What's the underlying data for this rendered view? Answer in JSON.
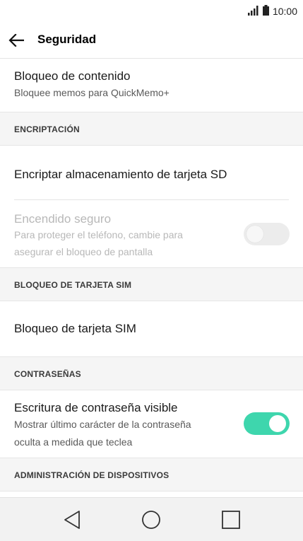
{
  "status_bar": {
    "time": "10:00",
    "signal_icon": "signal-bars-icon",
    "battery_icon": "battery-icon"
  },
  "toolbar": {
    "back_icon": "arrow-left-icon",
    "title": "Seguridad"
  },
  "items": {
    "content_lock": {
      "title": "Bloqueo de contenido",
      "summary": "Bloquee memos para QuickMemo+"
    },
    "encrypt_sd": {
      "title": "Encriptar almacenamiento de tarjeta SD"
    },
    "secure_startup": {
      "title": "Encendido seguro",
      "summary_line1": "Para proteger el teléfono, cambie para",
      "summary_line2": "asegurar el bloqueo de pantalla",
      "enabled": false,
      "checked": false
    },
    "sim_lock": {
      "title": "Bloqueo de tarjeta SIM"
    },
    "password_visible": {
      "title": "Escritura de contraseña visible",
      "summary_line1": "Mostrar último carácter de la contraseña",
      "summary_line2": "oculta a medida que teclea",
      "checked": true
    }
  },
  "sections": {
    "encryption": "ENCRIPTACIÓN",
    "sim_lock": "BLOQUEO DE TARJETA SIM",
    "passwords": "CONTRASEÑAS",
    "device_admin": "ADMINISTRACIÓN DE DISPOSITIVOS"
  },
  "nav_bar": {
    "back_icon": "triangle-back-icon",
    "home_icon": "circle-home-icon",
    "recents_icon": "square-recents-icon"
  },
  "colors": {
    "accent": "#3ed6ad",
    "section_bg": "#f5f5f5",
    "divider": "#e4e4e4"
  }
}
